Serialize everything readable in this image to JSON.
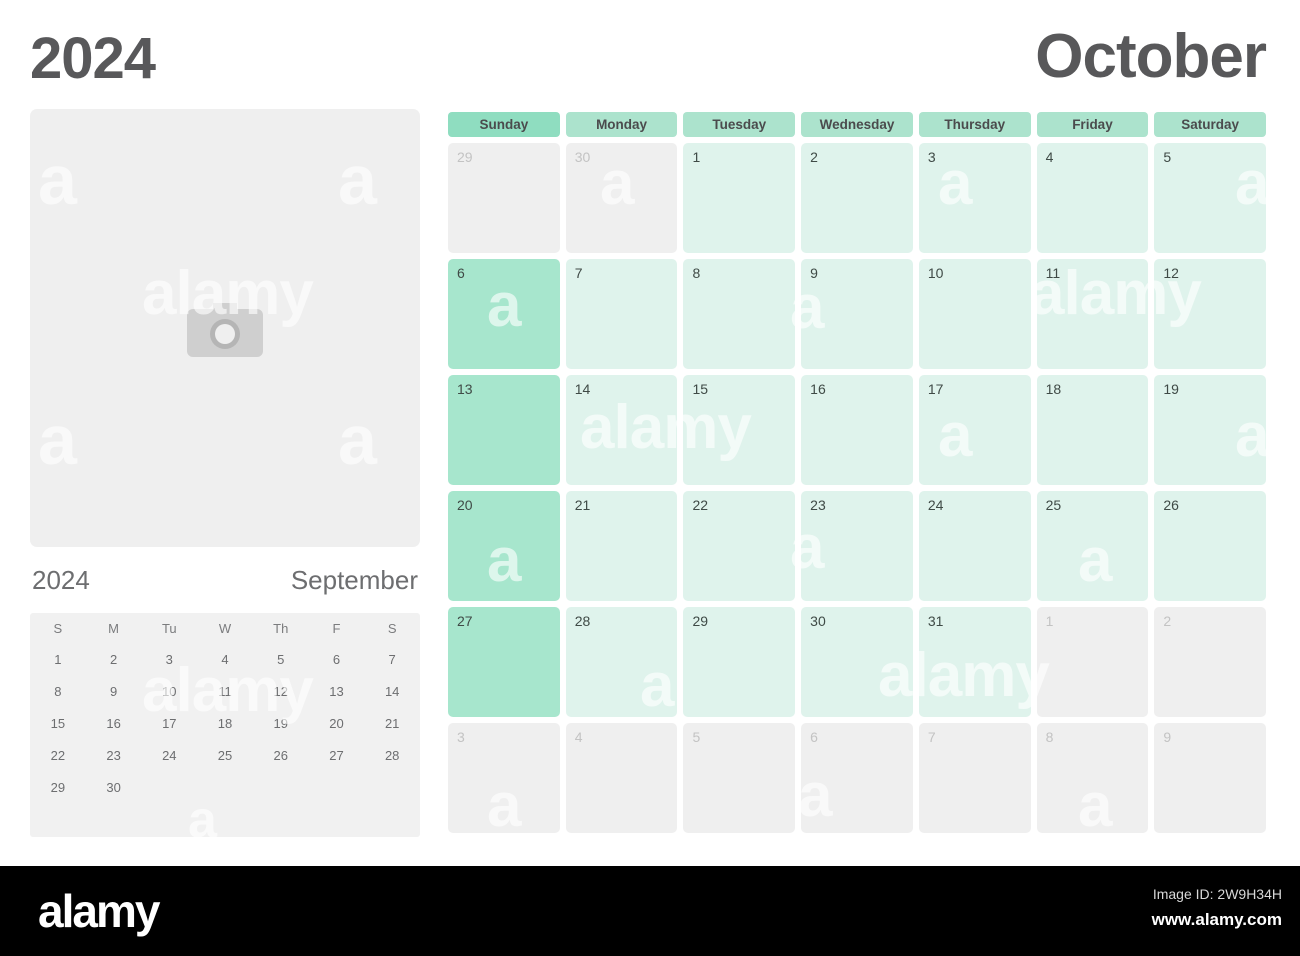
{
  "header": {
    "year": "2024",
    "month": "October"
  },
  "photo": {
    "icon": "camera-icon"
  },
  "mini_calendar": {
    "year": "2024",
    "month": "September",
    "dow": [
      "S",
      "M",
      "Tu",
      "W",
      "Th",
      "F",
      "S"
    ],
    "weeks": [
      [
        "1",
        "2",
        "3",
        "4",
        "5",
        "6",
        "7"
      ],
      [
        "8",
        "9",
        "10",
        "11",
        "12",
        "13",
        "14"
      ],
      [
        "15",
        "16",
        "17",
        "18",
        "19",
        "20",
        "21"
      ],
      [
        "22",
        "23",
        "24",
        "25",
        "26",
        "27",
        "28"
      ],
      [
        "29",
        "30",
        "",
        "",
        "",
        "",
        ""
      ]
    ]
  },
  "main_calendar": {
    "dow": [
      "Sunday",
      "Monday",
      "Tuesday",
      "Wednesday",
      "Thursday",
      "Friday",
      "Saturday"
    ],
    "weeks": [
      [
        {
          "n": "29",
          "out": true
        },
        {
          "n": "30",
          "out": true
        },
        {
          "n": "1",
          "out": false
        },
        {
          "n": "2",
          "out": false
        },
        {
          "n": "3",
          "out": false
        },
        {
          "n": "4",
          "out": false
        },
        {
          "n": "5",
          "out": false
        }
      ],
      [
        {
          "n": "6",
          "out": false
        },
        {
          "n": "7",
          "out": false
        },
        {
          "n": "8",
          "out": false
        },
        {
          "n": "9",
          "out": false
        },
        {
          "n": "10",
          "out": false
        },
        {
          "n": "11",
          "out": false
        },
        {
          "n": "12",
          "out": false
        }
      ],
      [
        {
          "n": "13",
          "out": false
        },
        {
          "n": "14",
          "out": false
        },
        {
          "n": "15",
          "out": false
        },
        {
          "n": "16",
          "out": false
        },
        {
          "n": "17",
          "out": false
        },
        {
          "n": "18",
          "out": false
        },
        {
          "n": "19",
          "out": false
        }
      ],
      [
        {
          "n": "20",
          "out": false
        },
        {
          "n": "21",
          "out": false
        },
        {
          "n": "22",
          "out": false
        },
        {
          "n": "23",
          "out": false
        },
        {
          "n": "24",
          "out": false
        },
        {
          "n": "25",
          "out": false
        },
        {
          "n": "26",
          "out": false
        }
      ],
      [
        {
          "n": "27",
          "out": false
        },
        {
          "n": "28",
          "out": false
        },
        {
          "n": "29",
          "out": false
        },
        {
          "n": "30",
          "out": false
        },
        {
          "n": "31",
          "out": false
        },
        {
          "n": "1",
          "out": true
        },
        {
          "n": "2",
          "out": true
        }
      ],
      [
        {
          "n": "3",
          "out": true
        },
        {
          "n": "4",
          "out": true
        },
        {
          "n": "5",
          "out": true
        },
        {
          "n": "6",
          "out": true
        },
        {
          "n": "7",
          "out": true
        },
        {
          "n": "8",
          "out": true
        },
        {
          "n": "9",
          "out": true
        }
      ]
    ]
  },
  "watermark": {
    "text": "alamy",
    "letter": "a"
  },
  "footer": {
    "logo": "alamy",
    "image_id": "Image ID: 2W9H34H",
    "url": "www.alamy.com"
  },
  "colors": {
    "sunday_header": "#8fddc0",
    "weekday_header": "#ace3cd",
    "sunday_cell": "#a7e6cd",
    "weekday_cell": "#dff3ec",
    "out_of_month_cell": "#efefef",
    "title_text": "#58585a",
    "footer_bg": "#000000"
  }
}
